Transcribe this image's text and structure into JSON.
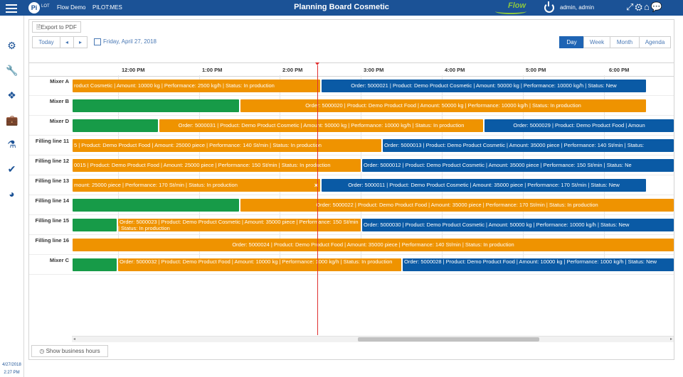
{
  "header": {
    "logo_text": "LOT",
    "logo_letter": "Pi",
    "app_name": "Flow Demo",
    "system": "PILOT:MES",
    "title": "Planning Board Cosmetic",
    "flow_logo": "Flow",
    "user": "admin, admin"
  },
  "sidebar": {
    "date": "4/27/2018",
    "time": "2:27 PM"
  },
  "toolbar": {
    "export_label": "Export to PDF",
    "today_label": "Today",
    "prev_label": "◂",
    "next_label": "▸",
    "date_label": "Friday, April 27, 2018",
    "views": [
      {
        "label": "Day",
        "active": true
      },
      {
        "label": "Week",
        "active": false
      },
      {
        "label": "Month",
        "active": false
      },
      {
        "label": "Agenda",
        "active": false
      }
    ],
    "business_hours_label": "Show business hours"
  },
  "timeline": {
    "hours": [
      "12:00 PM",
      "1:00 PM",
      "2:00 PM",
      "3:00 PM",
      "4:00 PM",
      "5:00 PM",
      "6:00 PM"
    ]
  },
  "rows": [
    {
      "label": "Mixer A",
      "bars": [
        {
          "color": "orange",
          "text": "roduct Cosmetic | Amount: 10000 kg | Performance: 2500 kg/h | Status: In production"
        },
        {
          "color": "blue",
          "text": "Order: 5000021 | Product: Demo Product Cosmetic | Amount: 50000 kg | Performance: 10000 kg/h | Status: New"
        }
      ]
    },
    {
      "label": "Mixer B",
      "bars": [
        {
          "color": "green",
          "text": ""
        },
        {
          "color": "orange",
          "text": "Order: 5000020 | Product: Demo Product Food | Amount: 50000 kg | Performance: 10000 kg/h | Status: In production"
        }
      ]
    },
    {
      "label": "Mixer D",
      "bars": [
        {
          "color": "green",
          "text": ""
        },
        {
          "color": "orange",
          "text": "Order: 5000031 | Product: Demo Product Cosmetic | Amount: 50000 kg | Performance: 10000 kg/h | Status: In production"
        },
        {
          "color": "blue",
          "text": "Order: 5000029 | Product: Demo Product Food | Amoun"
        }
      ]
    },
    {
      "label": "Filling line 11",
      "bars": [
        {
          "color": "orange",
          "text": "5 | Product: Demo Product Food | Amount: 25000 piece | Performance: 140 St/min | Status: In production"
        },
        {
          "color": "blue",
          "text": "Order: 5000013 | Product: Demo Product Cosmetic | Amount: 35000 piece | Performance: 140 St/min | Status:"
        }
      ]
    },
    {
      "label": "Filling line 12",
      "bars": [
        {
          "color": "orange",
          "text": "0015 | Product: Demo Product Food | Amount: 25000 piece | Performance: 150 St/min | Status: In production"
        },
        {
          "color": "blue",
          "text": "Order: 5000012 | Product: Demo Product Cosmetic | Amount: 35000 piece | Performance: 150 St/min | Status: Ne"
        }
      ]
    },
    {
      "label": "Filling line 13",
      "bars": [
        {
          "color": "orange",
          "text": "mount: 25000 piece | Performance: 170 St/min | Status: In production",
          "close": "×"
        },
        {
          "color": "blue",
          "text": "Order: 5000011 | Product: Demo Product Cosmetic | Amount: 35000 piece | Performance: 170 St/min | Status: New"
        }
      ]
    },
    {
      "label": "Filling line 14",
      "bars": [
        {
          "color": "green",
          "text": ""
        },
        {
          "color": "orange",
          "text": "Order: 5000022 | Product: Demo Product Food | Amount: 35000 piece | Performance: 170 St/min | Status: In production"
        }
      ]
    },
    {
      "label": "Filling line 15",
      "bars": [
        {
          "color": "green",
          "text": ""
        },
        {
          "color": "orange",
          "text": "Order: 5000023 | Product: Demo Product Cosmetic | Amount: 35000 piece | Performance: 150 St/min | Status: In production"
        },
        {
          "color": "blue",
          "text": "Order: 5000030 | Product: Demo Product Cosmetic | Amount: 50000 kg | Performance: 10000 kg/h | Status: New"
        }
      ]
    },
    {
      "label": "Filling line 16",
      "bars": [
        {
          "color": "orange",
          "text": "Order: 5000024 | Product: Demo Product Food | Amount: 35000 piece | Performance: 140 St/min | Status: In production"
        }
      ]
    },
    {
      "label": "Mixer C",
      "bars": [
        {
          "color": "green",
          "text": ""
        },
        {
          "color": "orange",
          "text": "Order: 5000032 | Product: Demo Product Food | Amount: 10000 kg | Performance: 1000 kg/h | Status: In production"
        },
        {
          "color": "blue",
          "text": "Order: 5000028 | Product: Demo Product Food | Amount: 10000 kg | Performance: 1000 kg/h | Status: New"
        }
      ]
    }
  ],
  "colors": {
    "orange": "#ef9300",
    "blue": "#0a5aa5",
    "green": "#179b48",
    "header": "#1b5296",
    "now_line": "#e03030"
  },
  "icons": [
    "menu-icon",
    "fullscreen-icon",
    "gear-icon",
    "home-icon",
    "chat-icon",
    "power-icon",
    "cogs-icon",
    "wrench-icon",
    "cubes-icon",
    "briefcase-icon",
    "flask-icon",
    "check-icon",
    "dashboard-icon"
  ]
}
